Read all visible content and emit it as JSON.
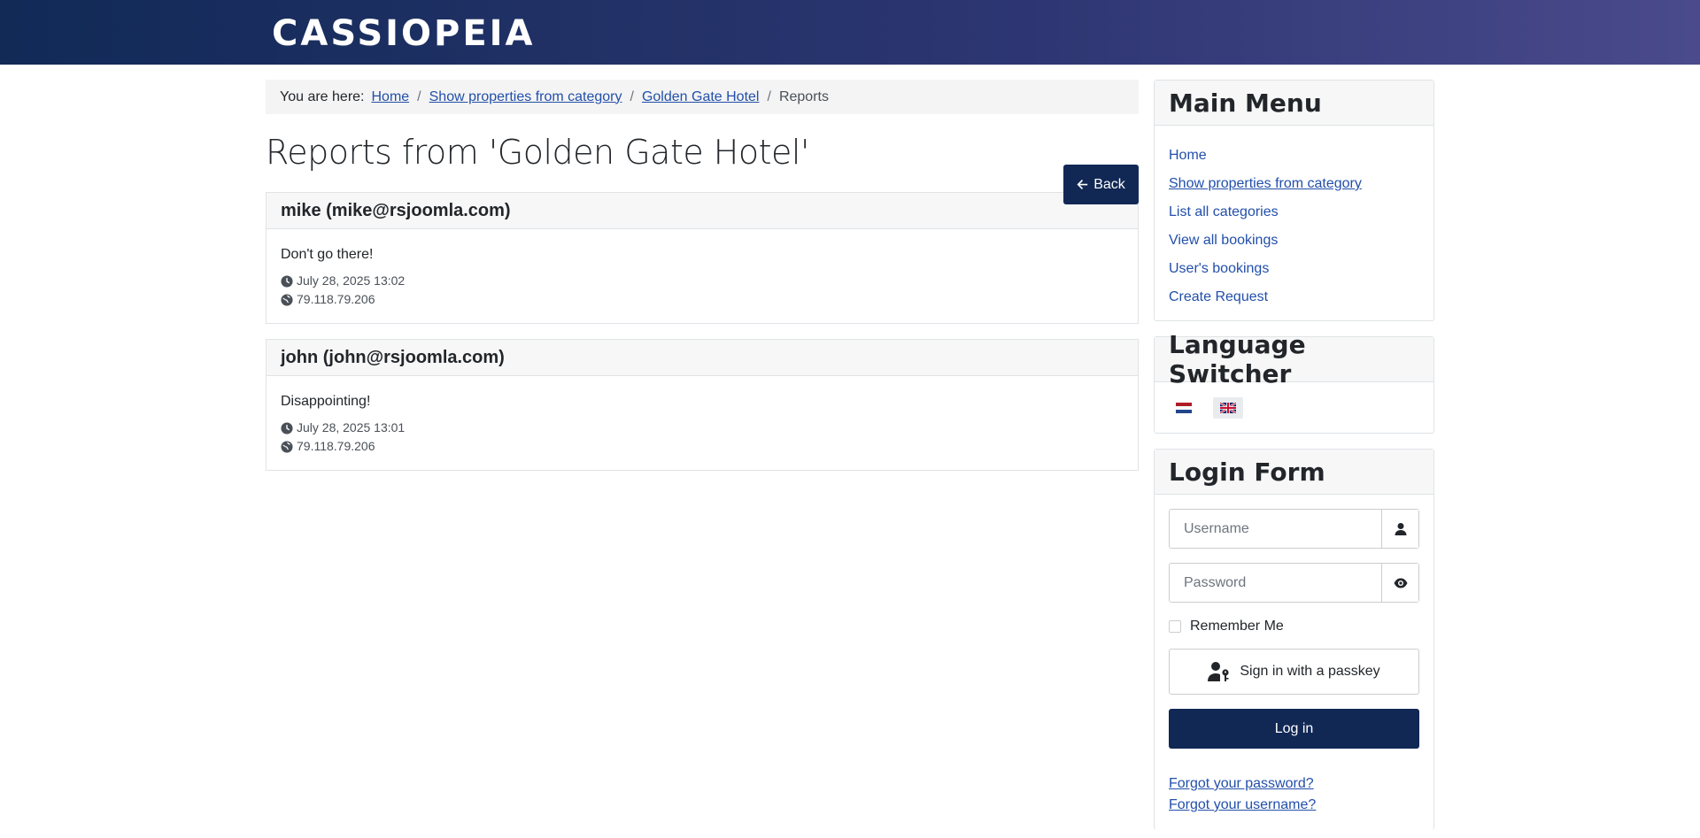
{
  "header": {
    "brand": "CASSIOPEIA"
  },
  "breadcrumb": {
    "prefix": "You are here:",
    "items": [
      {
        "label": "Home"
      },
      {
        "label": "Show properties from category"
      },
      {
        "label": "Golden Gate Hotel"
      }
    ],
    "current": "Reports",
    "separator": "/"
  },
  "main": {
    "title": "Reports from 'Golden Gate Hotel'",
    "back_label": "Back",
    "reports": [
      {
        "author": "mike (mike@rsjoomla.com)",
        "text": "Don't go there!",
        "date": "July 28, 2025 13:02",
        "ip": "79.118.79.206"
      },
      {
        "author": "john (john@rsjoomla.com)",
        "text": "Disappointing!",
        "date": "July 28, 2025 13:01",
        "ip": "79.118.79.206"
      }
    ]
  },
  "sidebar": {
    "main_menu": {
      "title": "Main Menu",
      "items": [
        {
          "label": "Home"
        },
        {
          "label": "Show properties from category"
        },
        {
          "label": "List all categories"
        },
        {
          "label": "View all bookings"
        },
        {
          "label": "User's bookings"
        },
        {
          "label": "Create Request"
        }
      ]
    },
    "language_switcher": {
      "title": "Language Switcher"
    },
    "login_form": {
      "title": "Login Form",
      "username_placeholder": "Username",
      "password_placeholder": "Password",
      "remember_label": "Remember Me",
      "passkey_label": "Sign in with a passkey",
      "login_label": "Log in",
      "forgot_password": "Forgot your password?",
      "forgot_username": "Forgot your username?"
    }
  },
  "colors": {
    "primary": "#112855",
    "link": "#224faa",
    "header_start": "#112a56",
    "header_end": "#4a4a8c"
  }
}
